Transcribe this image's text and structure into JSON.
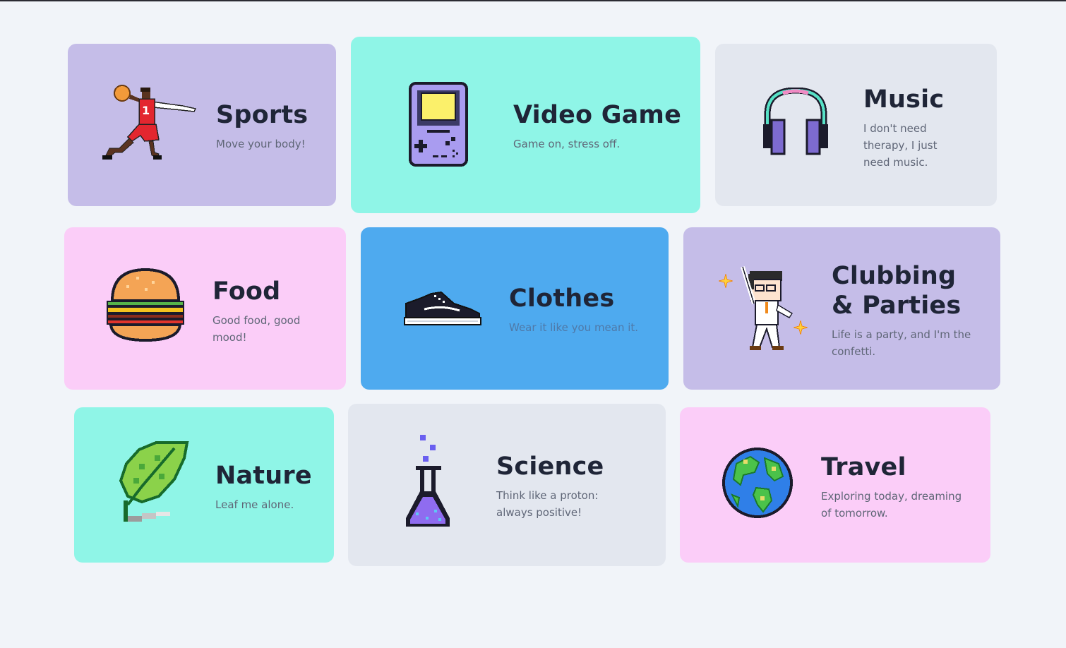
{
  "colors": {
    "page_bg": "#f1f4f9",
    "lavender": "#c5bde8",
    "mint": "#8ff5e7",
    "gray": "#e3e7ef",
    "pink": "#fbcdf8",
    "blue": "#4eaaef",
    "title": "#1f2537",
    "desc": "#5f6677"
  },
  "categories": [
    {
      "id": "sports",
      "title": "Sports",
      "desc": "Move your body!",
      "icon": "basketball-player-icon"
    },
    {
      "id": "video-game",
      "title": "Video Game",
      "desc": "Game on, stress off.",
      "icon": "gameboy-icon"
    },
    {
      "id": "music",
      "title": "Music",
      "desc": "I don't need therapy, I just need music.",
      "icon": "headphones-icon"
    },
    {
      "id": "food",
      "title": "Food",
      "desc": "Good food, good mood!",
      "icon": "burger-icon"
    },
    {
      "id": "clothes",
      "title": "Clothes",
      "desc": "Wear it like you mean it.",
      "icon": "sneaker-icon"
    },
    {
      "id": "clubbing",
      "title": "Clubbing\n& Parties",
      "desc": "Life is a party, and I'm the confetti.",
      "icon": "dancer-icon"
    },
    {
      "id": "nature",
      "title": "Nature",
      "desc": "Leaf me alone.",
      "icon": "leaf-icon"
    },
    {
      "id": "science",
      "title": "Science",
      "desc": "Think like a proton: always positive!",
      "icon": "flask-icon"
    },
    {
      "id": "travel",
      "title": "Travel",
      "desc": "Exploring today, dreaming of tomorrow.",
      "icon": "globe-icon"
    }
  ]
}
